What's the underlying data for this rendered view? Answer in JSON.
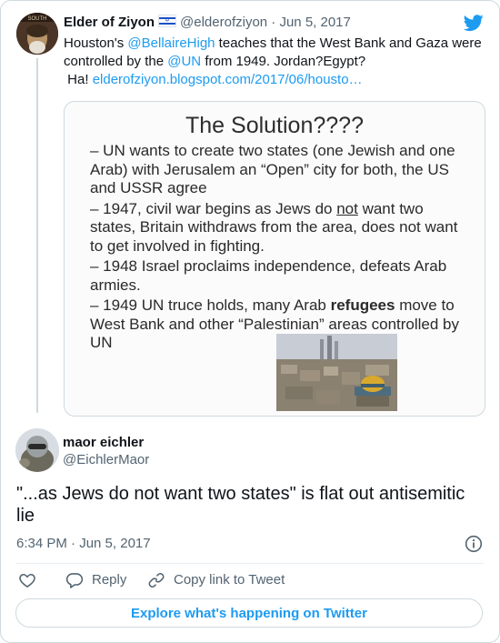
{
  "quoted_tweet": {
    "author_name": "Elder of Ziyon",
    "author_handle": "@elderofziyon",
    "date": "Jun 5, 2017",
    "text_1": "Houston's ",
    "mention_1": "@BellaireHigh",
    "text_2": " teaches that the West Bank and Gaza were controlled by the ",
    "mention_2": "@UN",
    "text_3": " from 1949. Jordan?Egypt?",
    "text_4": "Ha! ",
    "link": "elderofziyon.blogspot.com/2017/06/housto…",
    "flag_icon": "israel-flag-icon",
    "avatar_label": "SOUTH"
  },
  "slide": {
    "title": "The Solution????",
    "bullets": [
      "– UN wants to create two states (one Jewish and one Arab) with Jerusalem an “Open” city for both, the US and USSR agree",
      "– 1947, civil war begins as Jews do not want two states, Britain withdraws from the area, does not want to get involved in fighting.",
      "– 1948 Israel proclaims independence, defeats Arab armies.",
      "– 1949 UN truce holds, many Arab refugees move to West Bank and other “Palestinian” areas controlled by UN"
    ],
    "b2_pre": "– 1947, civil war begins as Jews do ",
    "b2_underline": "not",
    "b2_post": " want two states, Britain withdraws from the area, does not want to get involved in fighting.",
    "b4_pre": "– 1949 UN truce holds, many Arab ",
    "b4_bold": "refugees",
    "b4_post": " move to West Bank and other “Palestinian” areas controlled by UN"
  },
  "reply": {
    "author_name": "maor eichler",
    "author_handle": "@EichlerMaor",
    "text": "\"...as Jews do not want two states\" is flat out antisemitic lie",
    "timestamp": "6:34 PM · Jun 5, 2017"
  },
  "actions": {
    "reply_label": "Reply",
    "copy_label": "Copy link to Tweet",
    "explore_label": "Explore what's happening on Twitter"
  },
  "colors": {
    "accent": "#1d9bf0",
    "text": "#0f1419",
    "muted": "#536471",
    "border": "#cfd9de"
  },
  "icons": [
    "twitter-logo-icon",
    "heart-icon",
    "reply-icon",
    "link-icon",
    "info-icon",
    "israel-flag-icon"
  ]
}
